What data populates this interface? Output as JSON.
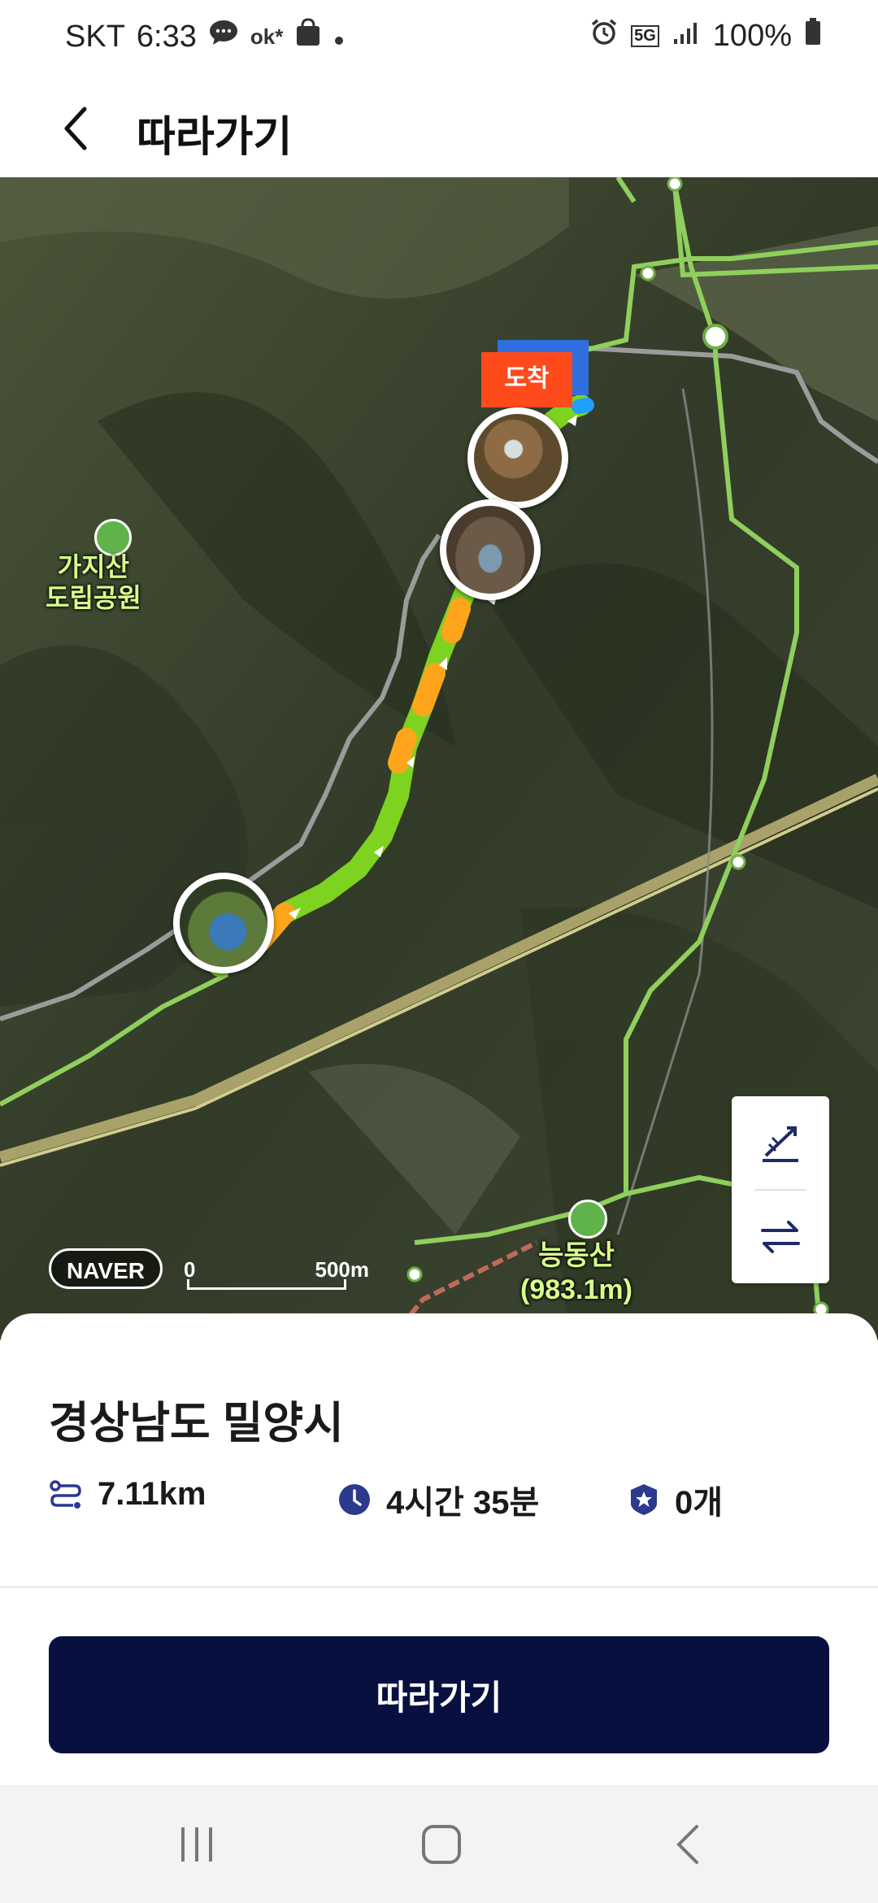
{
  "status_bar": {
    "carrier": "SKT",
    "time": "6:33",
    "network": "5G",
    "battery": "100%"
  },
  "header": {
    "title": "따라가기"
  },
  "map": {
    "park_label_line1": "가지산",
    "park_label_line2": "도립공원",
    "mountain_name": "능동산",
    "mountain_height": "(983.1m)",
    "arrival_label": "도착",
    "provider_logo": "NAVER",
    "scale_zero": "0",
    "scale_value": "500m",
    "route_color": "#7ed321",
    "route_accent_color": "#ffa51c"
  },
  "summary": {
    "region": "경상남도 밀양시",
    "distance": "7.11km",
    "duration": "4시간 35분",
    "badge_count": "0개"
  },
  "actions": {
    "follow_label": "따라가기"
  },
  "colors": {
    "button_bg": "#08103f",
    "icon_accent": "#2b3a8c",
    "arrive_flag": "#ff4a1c"
  }
}
